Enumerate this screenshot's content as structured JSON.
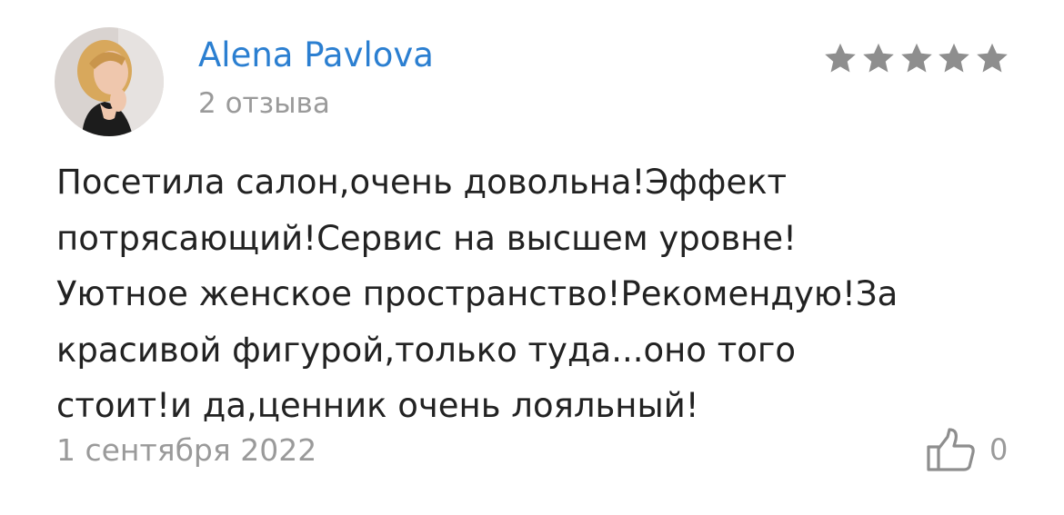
{
  "review": {
    "author": {
      "name": "Alena Pavlova",
      "reviews_count": "2 отзыва",
      "avatar_icon": "user-avatar-photo"
    },
    "rating": {
      "stars": 5,
      "max": 5,
      "color": "#8e8e8e"
    },
    "text_lines": [
      "Посетила салон,очень довольна!Эффект",
      "потрясающий!Сервис на высшем уровне!",
      "Уютное женское пространство!Рекомендую!За",
      "красивой фигурой,только туда...оно того",
      "стоит!и да,ценник очень лояльный!"
    ],
    "date": "1 сентября 2022",
    "likes": {
      "icon": "thumbs-up-icon",
      "count": "0"
    }
  },
  "colors": {
    "name": "#2b7fd1",
    "muted": "#9a9a9a",
    "text": "#222222",
    "background": "#ffffff"
  }
}
